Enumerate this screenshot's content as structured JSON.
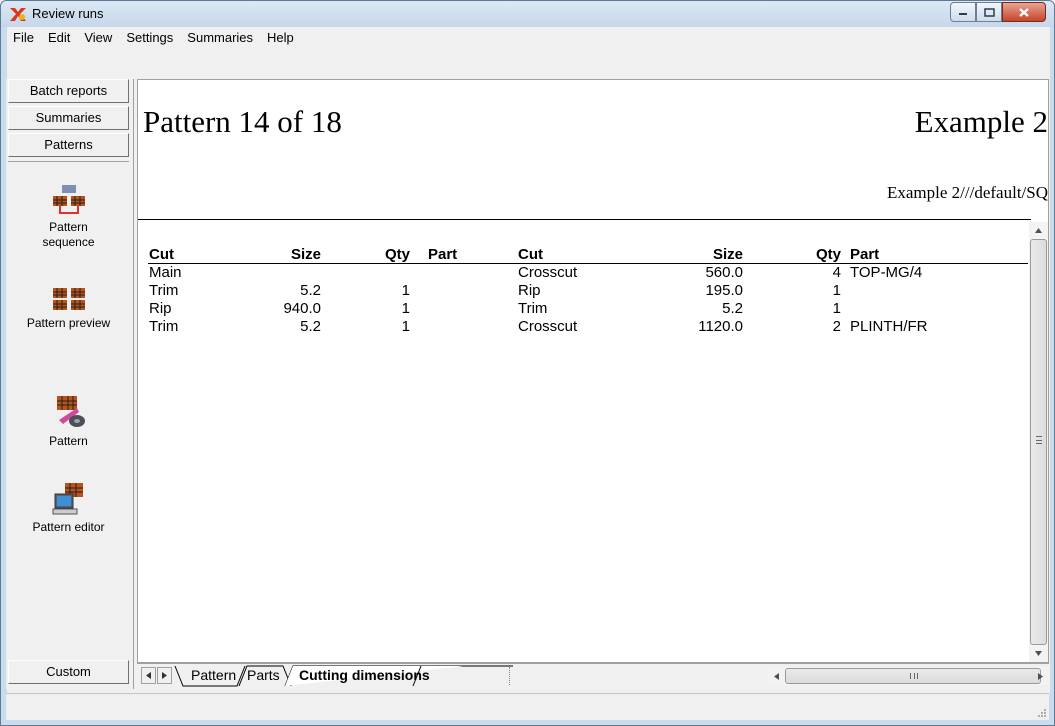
{
  "window": {
    "title": "Review runs",
    "icon": "app-x-icon"
  },
  "menu": [
    "File",
    "Edit",
    "View",
    "Settings",
    "Summaries",
    "Help"
  ],
  "leftbar": {
    "tabs": [
      "Batch reports",
      "Summaries",
      "Patterns"
    ],
    "items": [
      {
        "label_line1": "Pattern",
        "label_line2": "sequence",
        "icon": "pattern-sequence-icon"
      },
      {
        "label_line1": "Pattern preview",
        "label_line2": "",
        "icon": "pattern-preview-icon"
      },
      {
        "label_line1": "Pattern",
        "label_line2": "",
        "icon": "pattern-icon"
      },
      {
        "label_line1": "Pattern editor",
        "label_line2": "",
        "icon": "pattern-editor-icon"
      }
    ],
    "custom": "Custom"
  },
  "document": {
    "pattern_title": "Pattern 14 of 18",
    "example_title": "Example 2",
    "example_subtitle": "Example 2///default/SQ",
    "headers": {
      "cut1": "Cut",
      "size1": "Size",
      "qty1": "Qty",
      "part1": "Part",
      "cut2": "Cut",
      "size2": "Size",
      "qty2": "Qty",
      "part2": "Part"
    },
    "rows": [
      {
        "cut1": "Main",
        "size1": "",
        "qty1": "",
        "part1": "",
        "cut2": "Crosscut",
        "size2": "560.0",
        "qty2": "4",
        "part2": "TOP-MG/4"
      },
      {
        "cut1": "Trim",
        "size1": "5.2",
        "qty1": "1",
        "part1": "",
        "cut2": "Rip",
        "size2": "195.0",
        "qty2": "1",
        "part2": ""
      },
      {
        "cut1": "Rip",
        "size1": "940.0",
        "qty1": "1",
        "part1": "",
        "cut2": "Trim",
        "size2": "5.2",
        "qty2": "1",
        "part2": ""
      },
      {
        "cut1": "Trim",
        "size1": "5.2",
        "qty1": "1",
        "part1": "",
        "cut2": "Crosscut",
        "size2": "1120.0",
        "qty2": "2",
        "part2": "PLINTH/FR"
      }
    ]
  },
  "sheet_tabs": [
    "Pattern",
    "Parts",
    "Cutting dimensions"
  ],
  "active_sheet_tab": "Cutting dimensions",
  "colors": {
    "title_bar": "#c5d7ea",
    "close_button": "#c7442b",
    "panel": "#f0f0f0"
  }
}
